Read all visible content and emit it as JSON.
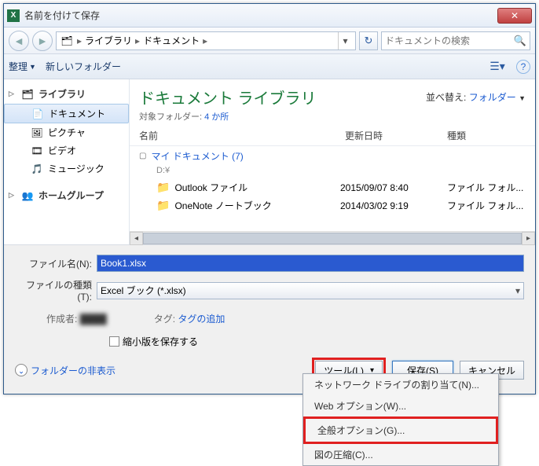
{
  "title": "名前を付けて保存",
  "breadcrumb": {
    "items": [
      "ライブラリ",
      "ドキュメント"
    ],
    "search_placeholder": "ドキュメントの検索"
  },
  "toolbar": {
    "organize": "整理",
    "new_folder": "新しいフォルダー"
  },
  "sidebar": {
    "library_label": "ライブラリ",
    "items": [
      {
        "label": "ドキュメント",
        "icon": "📄",
        "active": true
      },
      {
        "label": "ピクチャ",
        "icon": "🖼"
      },
      {
        "label": "ビデオ",
        "icon": "🎞"
      },
      {
        "label": "ミュージック",
        "icon": "🎵"
      }
    ],
    "homegroup": "ホームグループ"
  },
  "content": {
    "title": "ドキュメント ライブラリ",
    "subfolder_label": "対象フォルダー:",
    "subfolder_link": "4 か所",
    "sort_label": "並べ替え:",
    "sort_value": "フォルダー",
    "columns": {
      "name": "名前",
      "date": "更新日時",
      "type": "種類"
    },
    "group": {
      "name": "マイ ドキュメント",
      "count": "(7)",
      "path": "D:¥"
    },
    "rows": [
      {
        "name": "Outlook ファイル",
        "date": "2015/09/07 8:40",
        "type": "ファイル フォル..."
      },
      {
        "name": "OneNote ノートブック",
        "date": "2014/03/02 9:19",
        "type": "ファイル フォル..."
      }
    ]
  },
  "form": {
    "filename_label": "ファイル名(N):",
    "filename_value": "Book1.xlsx",
    "filetype_label": "ファイルの種類(T):",
    "filetype_value": "Excel ブック (*.xlsx)",
    "author_label": "作成者:",
    "author_value": "████",
    "tag_label": "タグ:",
    "tag_value": "タグの追加",
    "thumbnail_label": "縮小版を保存する",
    "hide_folder": "フォルダーの非表示",
    "tools_btn": "ツール(L)",
    "save_btn": "保存(S)",
    "cancel_btn": "キャンセル"
  },
  "menu": {
    "items": [
      "ネットワーク ドライブの割り当て(N)...",
      "Web オプション(W)...",
      "全般オプション(G)...",
      "図の圧縮(C)..."
    ]
  }
}
